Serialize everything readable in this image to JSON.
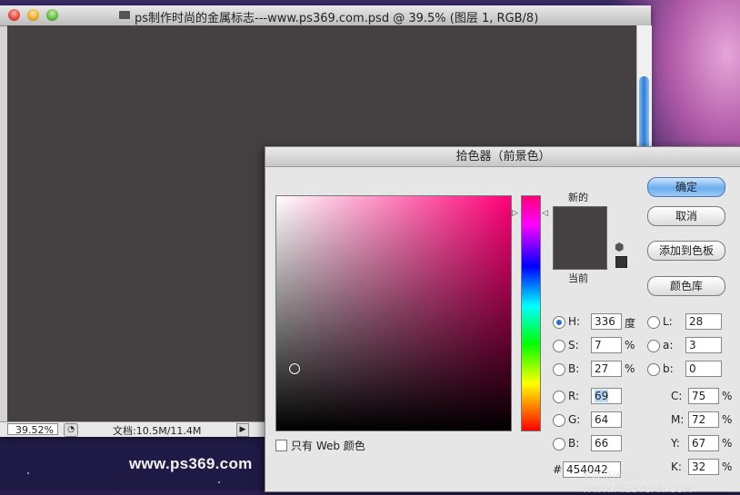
{
  "document_window": {
    "title": "ps制作时尚的金属标志---www.ps369.com.psd @ 39.5% (图层 1, RGB/8)",
    "zoom_value": "39.52%",
    "doc_info": "文档:10.5M/11.4M"
  },
  "desktop": {
    "url_text": "www.ps369.com",
    "watermark": "思缘设计论坛 WWW.MISSYUAN.COM"
  },
  "color_picker": {
    "title": "拾色器（前景色）",
    "label_new": "新的",
    "label_current": "当前",
    "new_color": "#454042",
    "current_color": "#454042",
    "buttons": {
      "ok": "确定",
      "cancel": "取消",
      "add_to_swatches": "添加到色板",
      "color_libraries": "颜色库"
    },
    "only_web_colors": "只有 Web 颜色",
    "fields": {
      "H": {
        "label": "H:",
        "value": "336",
        "unit": "度"
      },
      "S": {
        "label": "S:",
        "value": "7",
        "unit": "%"
      },
      "B": {
        "label": "B:",
        "value": "27",
        "unit": "%"
      },
      "R": {
        "label": "R:",
        "value": "69"
      },
      "G": {
        "label": "G:",
        "value": "64"
      },
      "Bb": {
        "label": "B:",
        "value": "66"
      },
      "L": {
        "label": "L:",
        "value": "28"
      },
      "a": {
        "label": "a:",
        "value": "3"
      },
      "b": {
        "label": "b:",
        "value": "0"
      },
      "C": {
        "label": "C:",
        "value": "75",
        "unit": "%"
      },
      "M": {
        "label": "M:",
        "value": "72",
        "unit": "%"
      },
      "Y": {
        "label": "Y:",
        "value": "67",
        "unit": "%"
      },
      "K": {
        "label": "K:",
        "value": "32",
        "unit": "%"
      }
    },
    "hex_label": "#",
    "hex_value": "454042",
    "selected_mode": "H"
  }
}
